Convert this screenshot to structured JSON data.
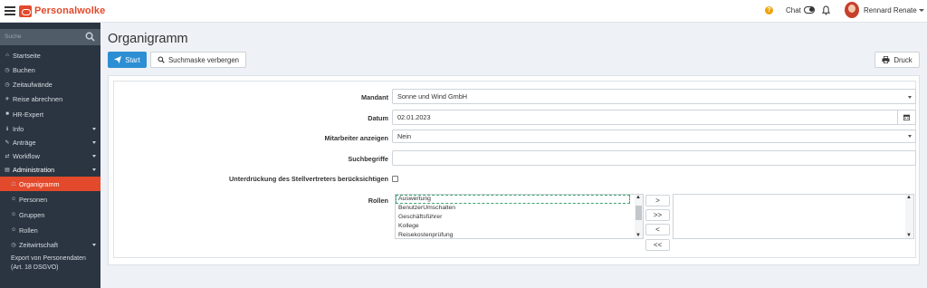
{
  "app": {
    "brand": "Personalwolke"
  },
  "header": {
    "chat_label": "Chat",
    "user_name": "Rennard Renate",
    "help": "?"
  },
  "sidebar": {
    "search_placeholder": "Suche",
    "items": [
      {
        "label": "Startseite",
        "icon": "⌂"
      },
      {
        "label": "Buchen",
        "icon": "◷"
      },
      {
        "label": "Zeitaufwände",
        "icon": "◷"
      },
      {
        "label": "Reise abrechnen",
        "icon": "✈"
      },
      {
        "label": "HR-Expert",
        "icon": "■"
      },
      {
        "label": "Info",
        "icon": "ℹ"
      },
      {
        "label": "Anträge",
        "icon": "✎"
      },
      {
        "label": "Workflow",
        "icon": "⇄"
      },
      {
        "label": "Administration",
        "icon": "▤"
      },
      {
        "label": "Organigramm",
        "icon": "☖"
      },
      {
        "label": "Personen",
        "icon": "☺"
      },
      {
        "label": "Gruppen",
        "icon": "☺"
      },
      {
        "label": "Rollen",
        "icon": "☺"
      },
      {
        "label": "Zeitwirtschaft",
        "icon": "◷"
      },
      {
        "label": "Export von Personendaten (Art. 18 DSGVO)"
      }
    ]
  },
  "main": {
    "title": "Organigramm",
    "start_label": "Start",
    "hide_label": "Suchmaske verbergen",
    "print_label": "Druck",
    "form": {
      "mandant_label": "Mandant",
      "mandant_value": "Sonne und Wind GmbH",
      "datum_label": "Datum",
      "datum_value": "02.01.2023",
      "mitarbeiter_label": "Mitarbeiter anzeigen",
      "mitarbeiter_value": "Nein",
      "suchbegriffe_label": "Suchbegriffe",
      "suchbegriffe_value": "",
      "unterdrueckung_label": "Unterdrückung des Stellvertreters berücksichtigen",
      "rollen_label": "Rollen",
      "rollen_options": [
        "Auswertung",
        "BenutzerUmschalten",
        "Geschäftsführer",
        "Kollege",
        "Reisekostenprüfung"
      ],
      "move_buttons": [
        ">",
        ">>",
        "<",
        "<<"
      ]
    }
  },
  "colors": {
    "accent": "#e3492b",
    "primary": "#2e8ed3",
    "sidebar": "#2b3542"
  }
}
